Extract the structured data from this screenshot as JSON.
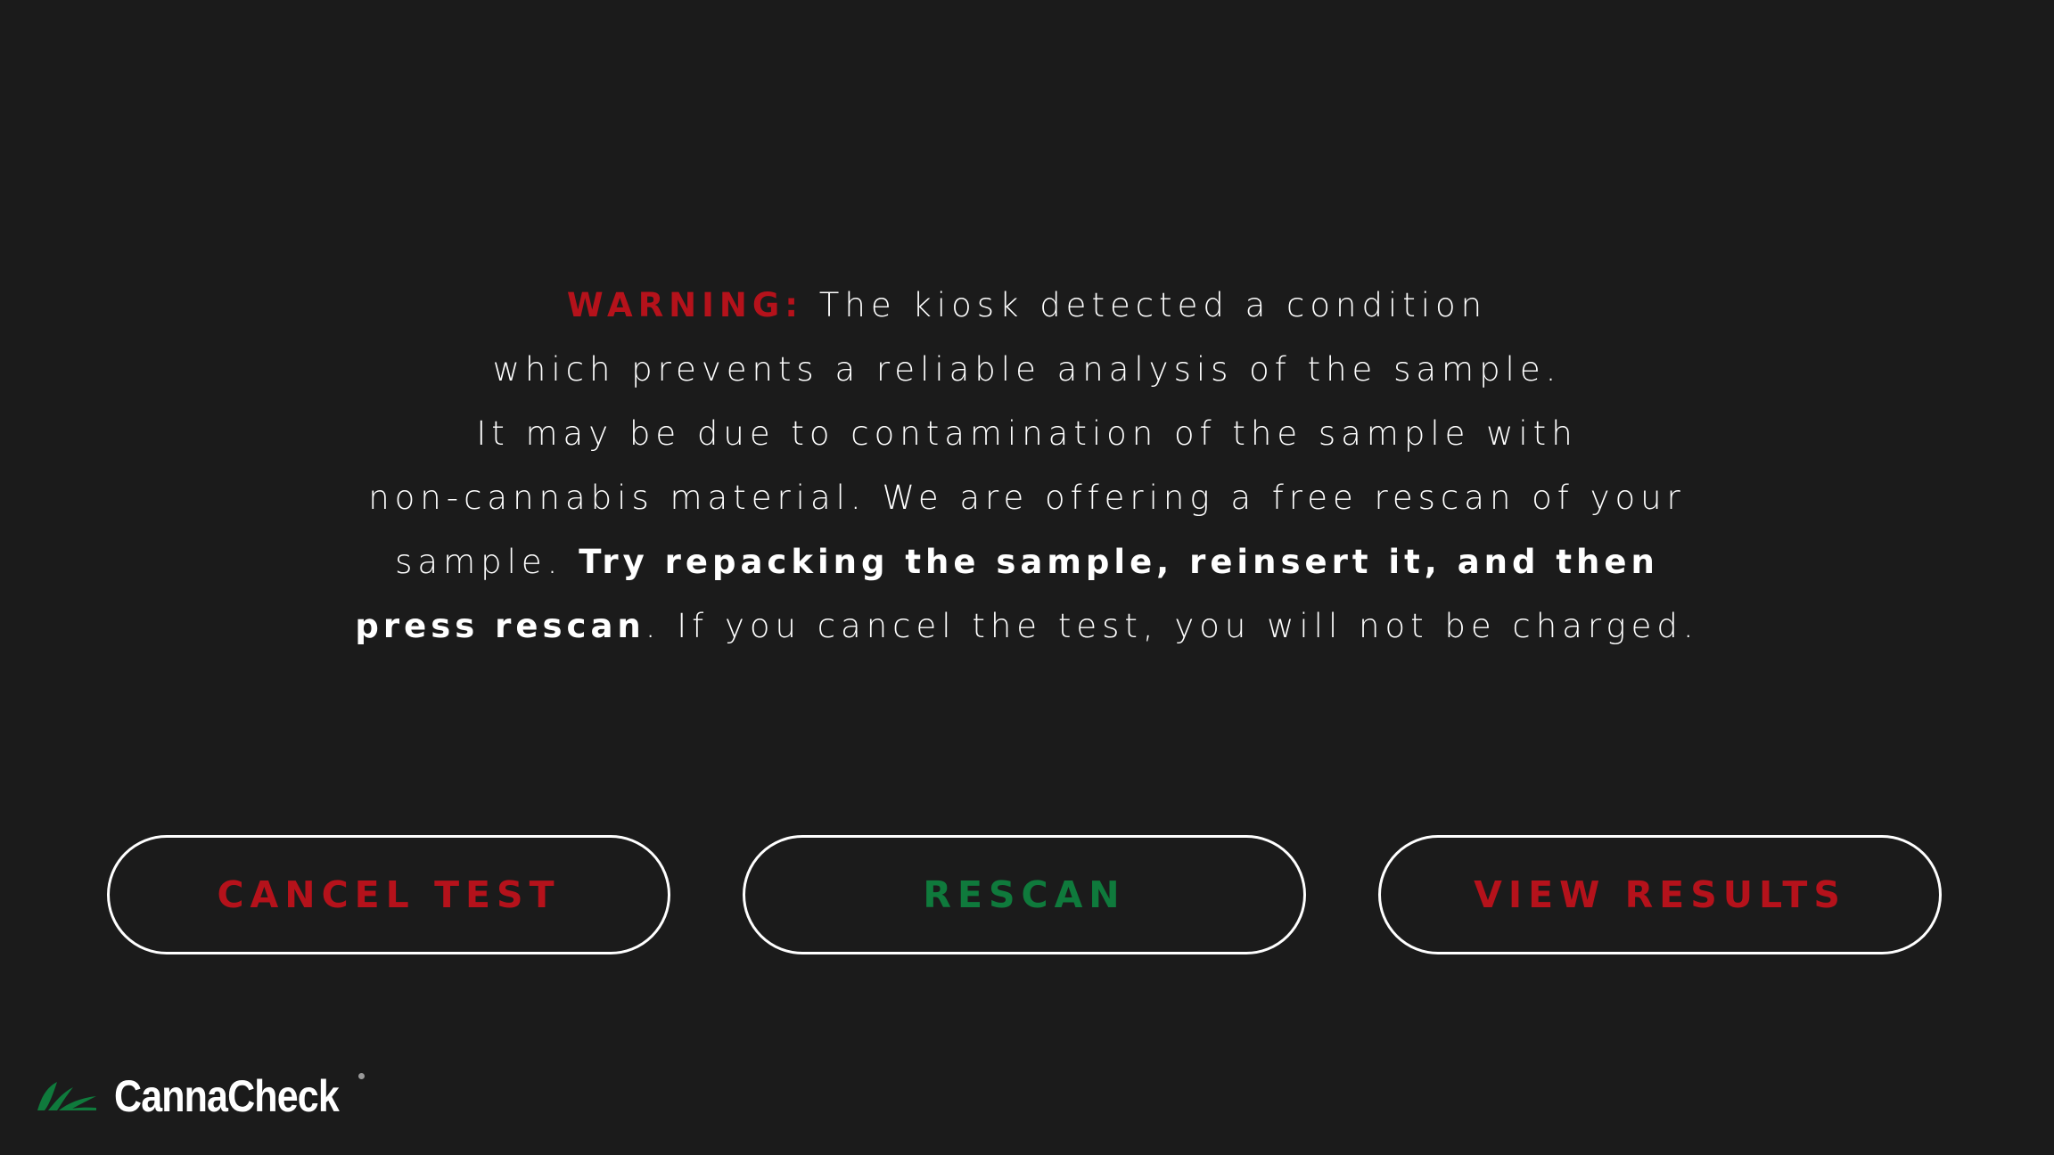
{
  "message": {
    "warning_label": "WARNING:",
    "line1_rest": " The kiosk detected a condition",
    "line2": "which prevents a reliable analysis of the sample.",
    "line3": "It may be due to contamination of the sample with",
    "line4": "non-cannabis material. We are offering a free rescan of your",
    "line5_plain": "sample. ",
    "line5_bold": "Try repacking the sample, reinsert it, and then",
    "line6_bold": "press rescan",
    "line6_rest": ". If you cancel the test, you will not be charged."
  },
  "buttons": {
    "cancel_label": "CANCEL TEST",
    "rescan_label": "RESCAN",
    "results_label": "VIEW RESULTS"
  },
  "brand": {
    "name": "CannaCheck",
    "logo_icon": "leaf-logo-icon"
  },
  "colors": {
    "background": "#1b1b1b",
    "warning_red": "#b5121b",
    "rescan_green": "#0f7a3c",
    "text": "#ffffff"
  }
}
